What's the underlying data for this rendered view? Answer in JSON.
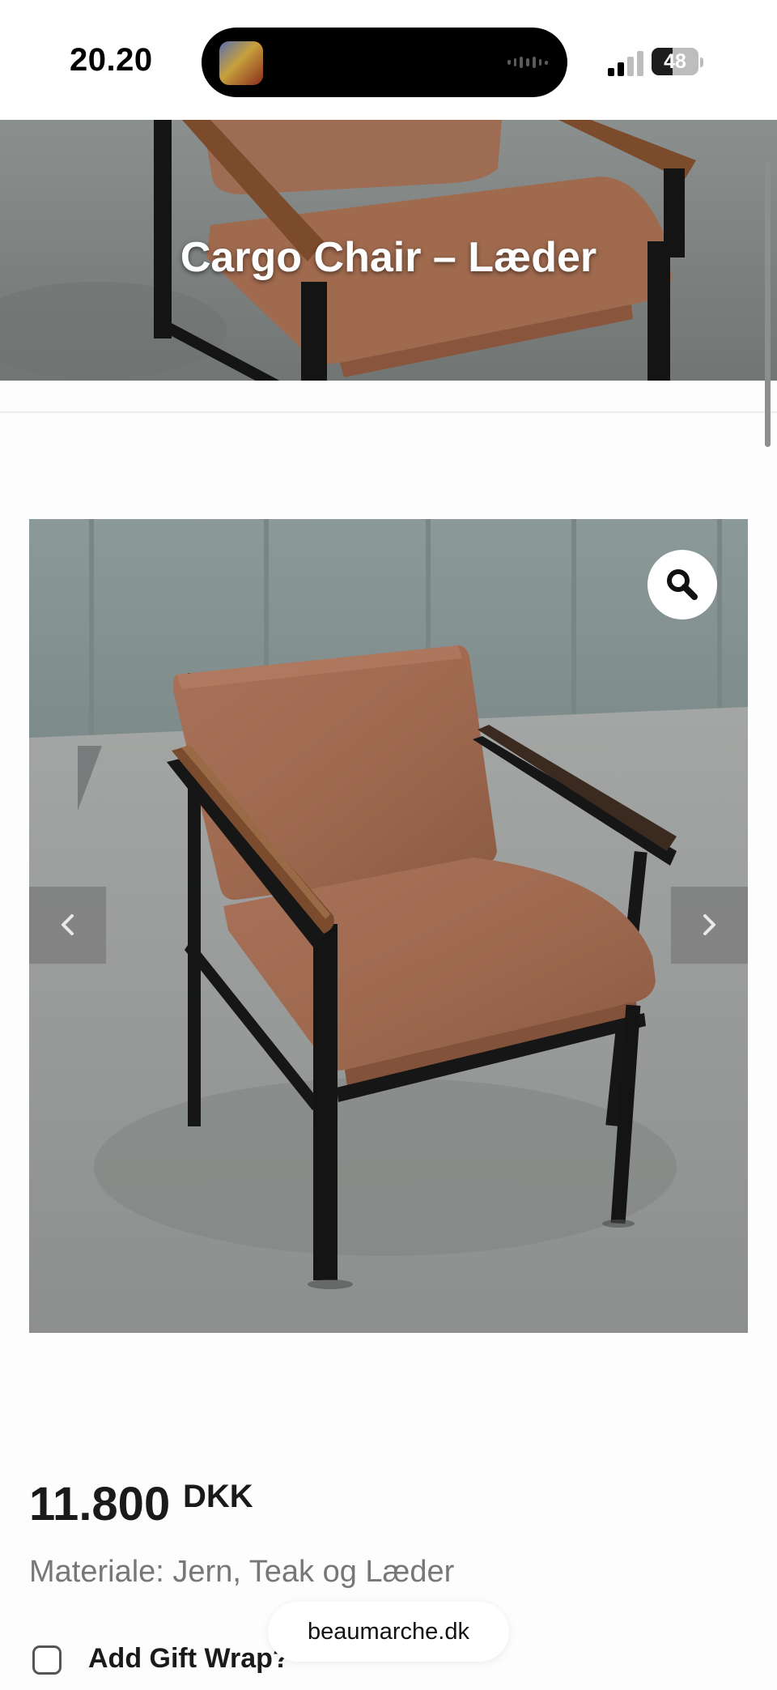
{
  "status_bar": {
    "time": "20.20",
    "battery": "48",
    "signal_icon": "cellular-signal-icon",
    "battery_icon": "battery-icon"
  },
  "product": {
    "title": "Cargo Chair – Læder",
    "price": "11.800",
    "currency": "DKK",
    "material": "Materiale: Jern, Teak og Læder",
    "gift_wrap_label": "Add Gift Wrap?",
    "gift_wrap_checked": false
  },
  "gallery": {
    "zoom_icon": "magnifier-icon",
    "prev_icon": "chevron-left-icon",
    "next_icon": "chevron-right-icon"
  },
  "browser": {
    "url": "beaumarche.dk"
  },
  "colors": {
    "leather": "#a06a4b",
    "frame": "#151515",
    "teak": "#7a4a2a",
    "concrete": "#9a9e9c"
  }
}
